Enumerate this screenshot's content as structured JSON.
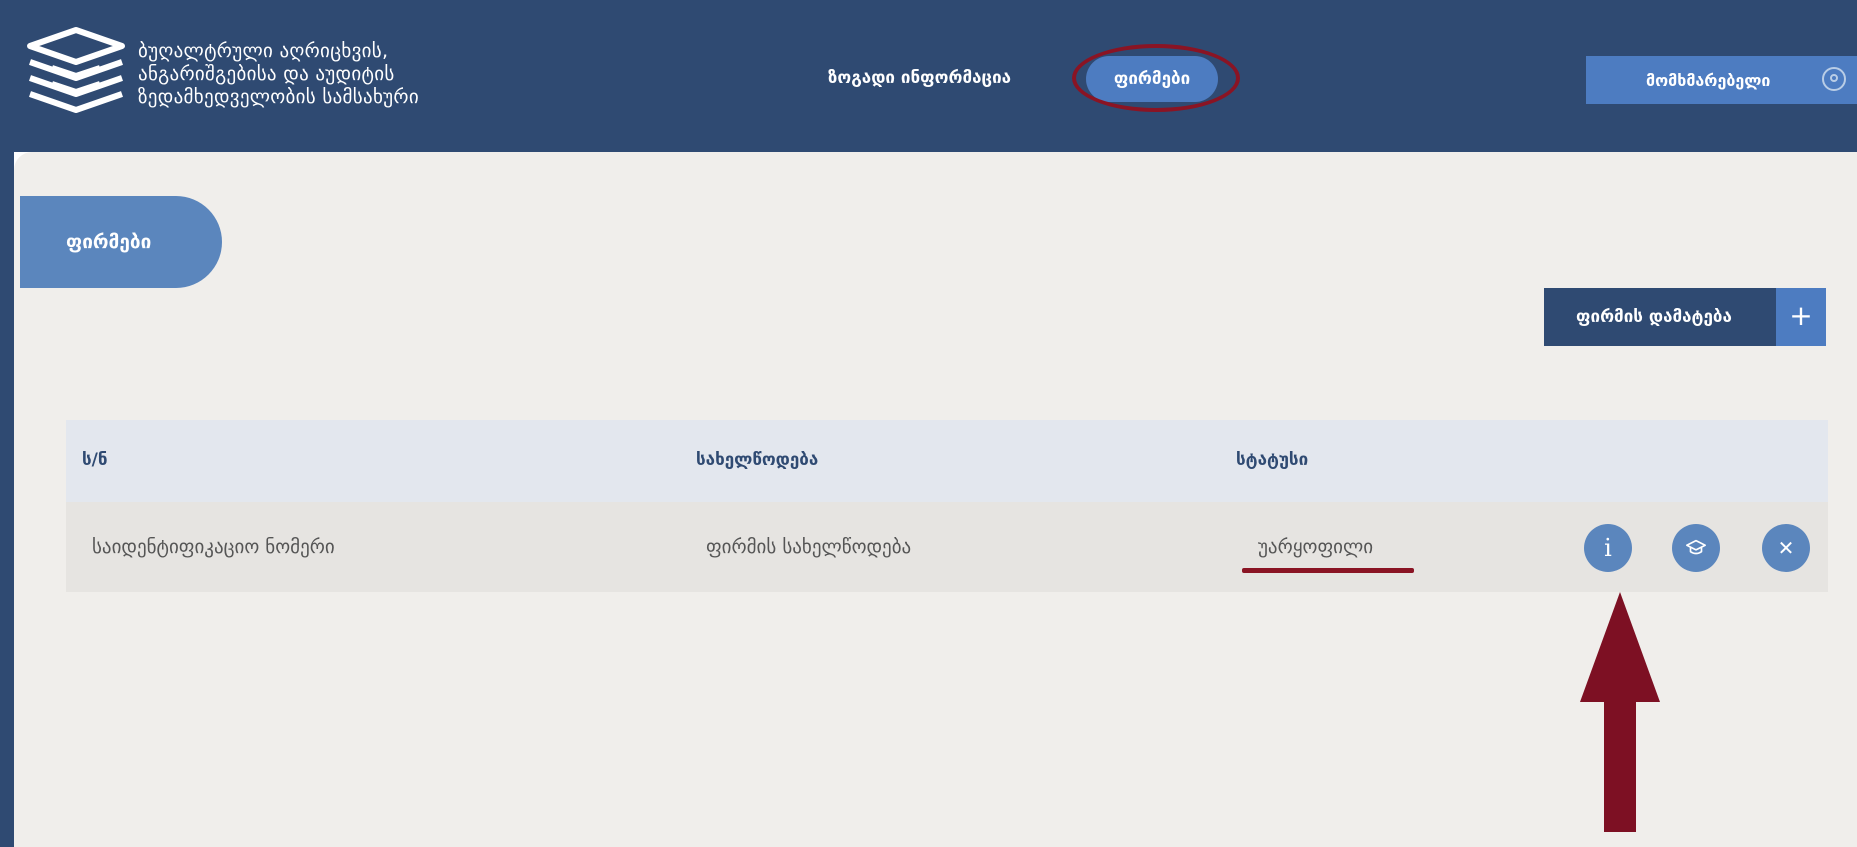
{
  "header": {
    "org_name_lines": [
      "ბუღალტრული აღრიცხვის,",
      "ანგარიშგებისა და აუდიტის",
      "ზედამხედველობის სამსახური"
    ],
    "nav": {
      "general_info": "ზოგადი ინფორმაცია",
      "firms": "ფირმები"
    },
    "user_button_label": "მომხმარებელი"
  },
  "page": {
    "tab_title": "ფირმები",
    "add_button_label": "ფირმის დამატება",
    "add_button_icon": "+"
  },
  "table": {
    "columns": [
      "ს/ნ",
      "სახელწოდება",
      "სტატუსი"
    ],
    "rows": [
      {
        "id": "საიდენტიფიკაციო ნომერი",
        "name": "ფირმის სახელწოდება",
        "status": "უარყოფილი",
        "actions": [
          "info-icon",
          "graduation-cap-icon",
          "close-icon"
        ]
      }
    ]
  },
  "colors": {
    "header_bg": "#2f4a72",
    "accent_blue": "#4d7cc1",
    "tab_blue": "#5b86bd",
    "content_bg": "#f0eeeb",
    "annotation_red": "#8a1424"
  },
  "action_glyphs": {
    "info": "i",
    "close": "✕"
  }
}
